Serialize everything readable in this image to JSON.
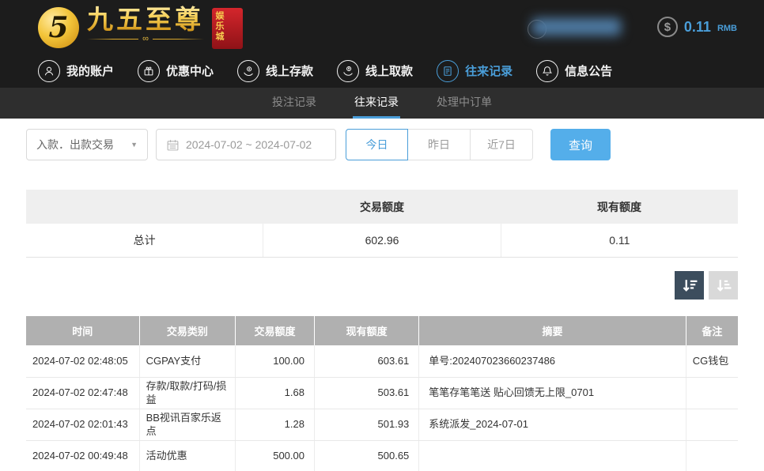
{
  "brand": {
    "logo_glyph": "5",
    "title": "九五至尊",
    "badge": "娱乐城"
  },
  "header": {
    "balance": "0.11",
    "currency": "RMB",
    "dollar_glyph": "$"
  },
  "nav": {
    "items": [
      {
        "label": "我的账户",
        "icon": "user-icon",
        "active": false
      },
      {
        "label": "优惠中心",
        "icon": "gift-icon",
        "active": false
      },
      {
        "label": "线上存款",
        "icon": "deposit-icon",
        "active": false
      },
      {
        "label": "线上取款",
        "icon": "withdraw-icon",
        "active": false
      },
      {
        "label": "往来记录",
        "icon": "records-icon",
        "active": true
      },
      {
        "label": "信息公告",
        "icon": "bell-icon",
        "active": false
      }
    ]
  },
  "subtabs": {
    "items": [
      {
        "label": "投注记录",
        "active": false
      },
      {
        "label": "往来记录",
        "active": true
      },
      {
        "label": "处理中订单",
        "active": false
      }
    ]
  },
  "filters": {
    "type_select_value": "入款．出款交易",
    "select_caret": "▼",
    "date_range_value": "2024-07-02 ~ 2024-07-02",
    "quick_today": "今日",
    "quick_yesterday": "昨日",
    "quick_7days": "近7日",
    "search_label": "查询"
  },
  "summary": {
    "headers": {
      "label": "",
      "transaction": "交易额度",
      "balance": "现有额度"
    },
    "total_label": "总计",
    "total_transaction": "602.96",
    "total_balance": "0.11"
  },
  "table": {
    "headers": [
      "时间",
      "交易类别",
      "交易额度",
      "现有额度",
      "摘要",
      "备注"
    ],
    "rows": [
      [
        "2024-07-02 02:48:05",
        "CGPAY支付",
        "100.00",
        "603.61",
        "单号:202407023660237486",
        "CG钱包"
      ],
      [
        "2024-07-02 02:47:48",
        "存款/取款/打码/损益",
        "1.68",
        "503.61",
        "笔笔存笔笔送 贴心回馈无上限_0701",
        ""
      ],
      [
        "2024-07-02 02:01:43",
        "BB视讯百家乐返点",
        "1.28",
        "501.93",
        "系统派发_2024-07-01",
        ""
      ],
      [
        "2024-07-02 00:49:48",
        "活动优惠",
        "500.00",
        "500.65",
        "",
        ""
      ]
    ]
  },
  "colors": {
    "accent_blue": "#4a9ed9",
    "search_button_blue": "#54aeea",
    "brand_gold": "#f6cd4f",
    "badge_red": "#b01e24",
    "topbar_black": "#1c1c1c",
    "subtab_bar": "#2e2e2e",
    "table_header_gray": "#b0b0b0",
    "sort_navy": "#3c4d5d"
  }
}
